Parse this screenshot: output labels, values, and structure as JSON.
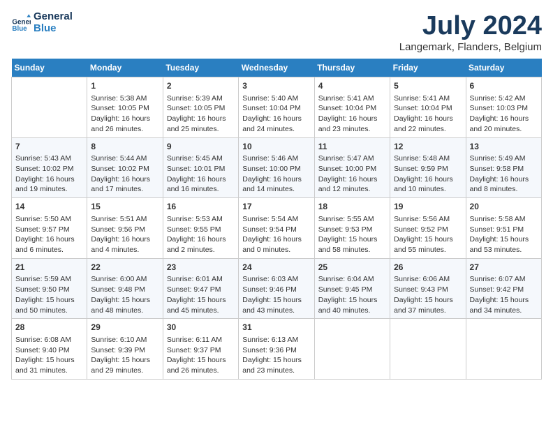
{
  "logo": {
    "line1": "General",
    "line2": "Blue"
  },
  "title": "July 2024",
  "subtitle": "Langemark, Flanders, Belgium",
  "days_header": [
    "Sunday",
    "Monday",
    "Tuesday",
    "Wednesday",
    "Thursday",
    "Friday",
    "Saturday"
  ],
  "weeks": [
    [
      {
        "num": "",
        "text": ""
      },
      {
        "num": "1",
        "text": "Sunrise: 5:38 AM\nSunset: 10:05 PM\nDaylight: 16 hours\nand 26 minutes."
      },
      {
        "num": "2",
        "text": "Sunrise: 5:39 AM\nSunset: 10:05 PM\nDaylight: 16 hours\nand 25 minutes."
      },
      {
        "num": "3",
        "text": "Sunrise: 5:40 AM\nSunset: 10:04 PM\nDaylight: 16 hours\nand 24 minutes."
      },
      {
        "num": "4",
        "text": "Sunrise: 5:41 AM\nSunset: 10:04 PM\nDaylight: 16 hours\nand 23 minutes."
      },
      {
        "num": "5",
        "text": "Sunrise: 5:41 AM\nSunset: 10:04 PM\nDaylight: 16 hours\nand 22 minutes."
      },
      {
        "num": "6",
        "text": "Sunrise: 5:42 AM\nSunset: 10:03 PM\nDaylight: 16 hours\nand 20 minutes."
      }
    ],
    [
      {
        "num": "7",
        "text": "Sunrise: 5:43 AM\nSunset: 10:02 PM\nDaylight: 16 hours\nand 19 minutes."
      },
      {
        "num": "8",
        "text": "Sunrise: 5:44 AM\nSunset: 10:02 PM\nDaylight: 16 hours\nand 17 minutes."
      },
      {
        "num": "9",
        "text": "Sunrise: 5:45 AM\nSunset: 10:01 PM\nDaylight: 16 hours\nand 16 minutes."
      },
      {
        "num": "10",
        "text": "Sunrise: 5:46 AM\nSunset: 10:00 PM\nDaylight: 16 hours\nand 14 minutes."
      },
      {
        "num": "11",
        "text": "Sunrise: 5:47 AM\nSunset: 10:00 PM\nDaylight: 16 hours\nand 12 minutes."
      },
      {
        "num": "12",
        "text": "Sunrise: 5:48 AM\nSunset: 9:59 PM\nDaylight: 16 hours\nand 10 minutes."
      },
      {
        "num": "13",
        "text": "Sunrise: 5:49 AM\nSunset: 9:58 PM\nDaylight: 16 hours\nand 8 minutes."
      }
    ],
    [
      {
        "num": "14",
        "text": "Sunrise: 5:50 AM\nSunset: 9:57 PM\nDaylight: 16 hours\nand 6 minutes."
      },
      {
        "num": "15",
        "text": "Sunrise: 5:51 AM\nSunset: 9:56 PM\nDaylight: 16 hours\nand 4 minutes."
      },
      {
        "num": "16",
        "text": "Sunrise: 5:53 AM\nSunset: 9:55 PM\nDaylight: 16 hours\nand 2 minutes."
      },
      {
        "num": "17",
        "text": "Sunrise: 5:54 AM\nSunset: 9:54 PM\nDaylight: 16 hours\nand 0 minutes."
      },
      {
        "num": "18",
        "text": "Sunrise: 5:55 AM\nSunset: 9:53 PM\nDaylight: 15 hours\nand 58 minutes."
      },
      {
        "num": "19",
        "text": "Sunrise: 5:56 AM\nSunset: 9:52 PM\nDaylight: 15 hours\nand 55 minutes."
      },
      {
        "num": "20",
        "text": "Sunrise: 5:58 AM\nSunset: 9:51 PM\nDaylight: 15 hours\nand 53 minutes."
      }
    ],
    [
      {
        "num": "21",
        "text": "Sunrise: 5:59 AM\nSunset: 9:50 PM\nDaylight: 15 hours\nand 50 minutes."
      },
      {
        "num": "22",
        "text": "Sunrise: 6:00 AM\nSunset: 9:48 PM\nDaylight: 15 hours\nand 48 minutes."
      },
      {
        "num": "23",
        "text": "Sunrise: 6:01 AM\nSunset: 9:47 PM\nDaylight: 15 hours\nand 45 minutes."
      },
      {
        "num": "24",
        "text": "Sunrise: 6:03 AM\nSunset: 9:46 PM\nDaylight: 15 hours\nand 43 minutes."
      },
      {
        "num": "25",
        "text": "Sunrise: 6:04 AM\nSunset: 9:45 PM\nDaylight: 15 hours\nand 40 minutes."
      },
      {
        "num": "26",
        "text": "Sunrise: 6:06 AM\nSunset: 9:43 PM\nDaylight: 15 hours\nand 37 minutes."
      },
      {
        "num": "27",
        "text": "Sunrise: 6:07 AM\nSunset: 9:42 PM\nDaylight: 15 hours\nand 34 minutes."
      }
    ],
    [
      {
        "num": "28",
        "text": "Sunrise: 6:08 AM\nSunset: 9:40 PM\nDaylight: 15 hours\nand 31 minutes."
      },
      {
        "num": "29",
        "text": "Sunrise: 6:10 AM\nSunset: 9:39 PM\nDaylight: 15 hours\nand 29 minutes."
      },
      {
        "num": "30",
        "text": "Sunrise: 6:11 AM\nSunset: 9:37 PM\nDaylight: 15 hours\nand 26 minutes."
      },
      {
        "num": "31",
        "text": "Sunrise: 6:13 AM\nSunset: 9:36 PM\nDaylight: 15 hours\nand 23 minutes."
      },
      {
        "num": "",
        "text": ""
      },
      {
        "num": "",
        "text": ""
      },
      {
        "num": "",
        "text": ""
      }
    ]
  ]
}
